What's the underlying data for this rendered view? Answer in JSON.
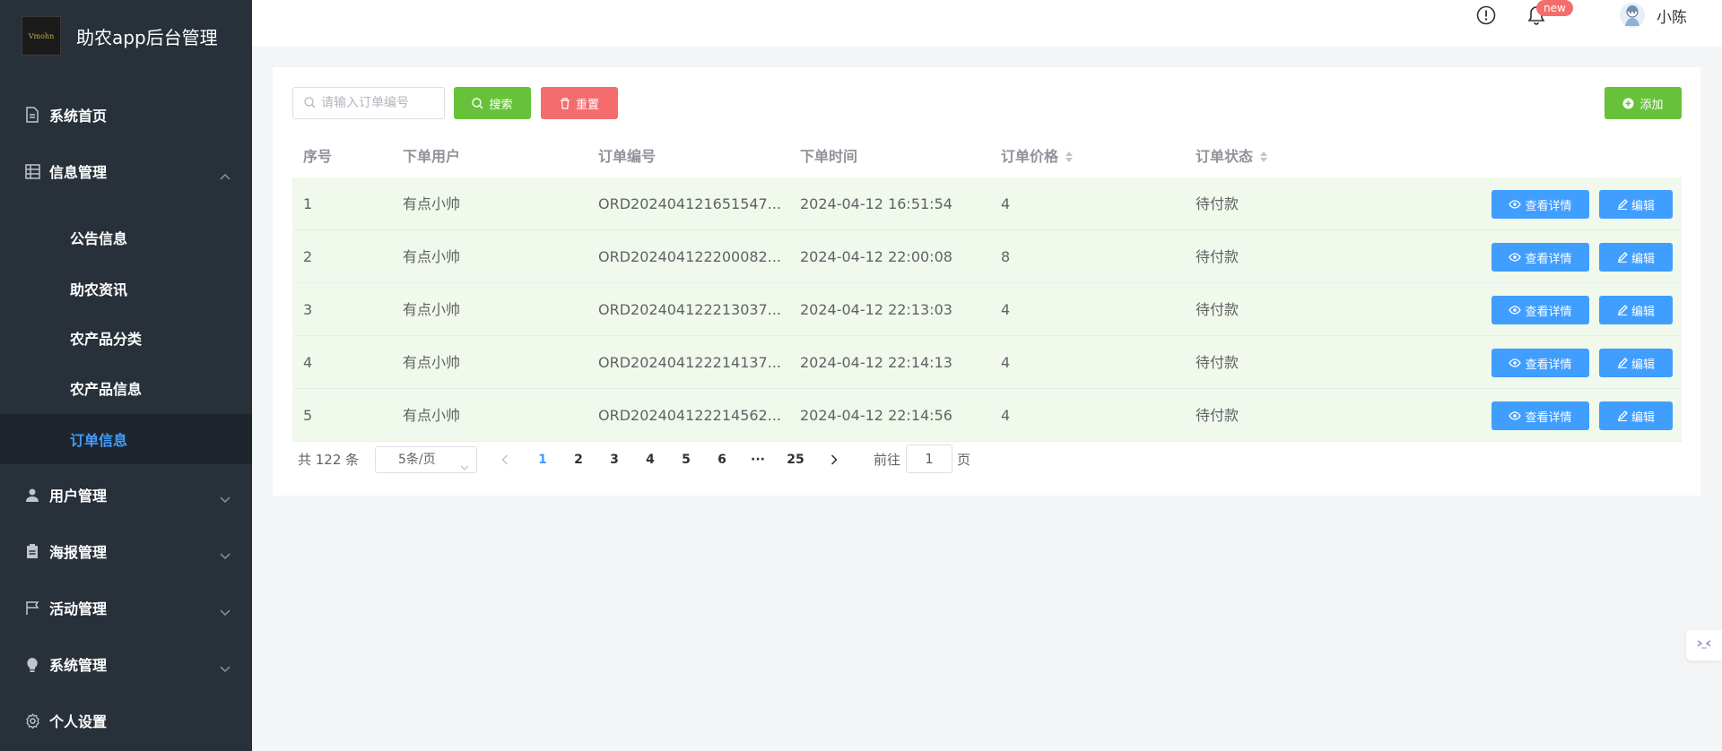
{
  "app": {
    "title": "助农app后台管理",
    "logo_text": "Vmohn"
  },
  "sidebar": {
    "items": [
      {
        "label": "系统首页",
        "icon": "document-icon"
      },
      {
        "label": "信息管理",
        "icon": "grid-icon",
        "expanded": true
      },
      {
        "label": "用户管理",
        "icon": "user-icon"
      },
      {
        "label": "海报管理",
        "icon": "clipboard-icon"
      },
      {
        "label": "活动管理",
        "icon": "flag-icon"
      },
      {
        "label": "系统管理",
        "icon": "bulb-icon"
      },
      {
        "label": "个人设置",
        "icon": "gear-icon"
      }
    ],
    "subitems": [
      {
        "label": "公告信息"
      },
      {
        "label": "助农资讯"
      },
      {
        "label": "农产品分类"
      },
      {
        "label": "农产品信息"
      },
      {
        "label": "订单信息",
        "active": true
      }
    ]
  },
  "header": {
    "badge": "new",
    "username": "小陈"
  },
  "toolbar": {
    "search_placeholder": "请输入订单编号",
    "search_label": "搜索",
    "reset_label": "重置",
    "add_label": "添加"
  },
  "table": {
    "columns": [
      "序号",
      "下单用户",
      "订单编号",
      "下单时间",
      "订单价格",
      "订单状态"
    ],
    "view_label": "查看详情",
    "edit_label": "编辑",
    "rows": [
      {
        "index": "1",
        "user": "有点小帅",
        "order_no": "ORD202404121651547...",
        "time": "2024-04-12 16:51:54",
        "price": "4",
        "status": "待付款"
      },
      {
        "index": "2",
        "user": "有点小帅",
        "order_no": "ORD202404122200082...",
        "time": "2024-04-12 22:00:08",
        "price": "8",
        "status": "待付款"
      },
      {
        "index": "3",
        "user": "有点小帅",
        "order_no": "ORD202404122213037...",
        "time": "2024-04-12 22:13:03",
        "price": "4",
        "status": "待付款"
      },
      {
        "index": "4",
        "user": "有点小帅",
        "order_no": "ORD202404122214137...",
        "time": "2024-04-12 22:14:13",
        "price": "4",
        "status": "待付款"
      },
      {
        "index": "5",
        "user": "有点小帅",
        "order_no": "ORD202404122214562...",
        "time": "2024-04-12 22:14:56",
        "price": "4",
        "status": "待付款"
      }
    ]
  },
  "pagination": {
    "total_text": "共 122 条",
    "page_size": "5条/页",
    "pages": [
      "1",
      "2",
      "3",
      "4",
      "5",
      "6",
      "···",
      "25"
    ],
    "current": "1",
    "goto_prefix": "前往",
    "goto_value": "1",
    "goto_suffix": "页"
  },
  "colors": {
    "sidebar_bg": "#28303a",
    "active_blue": "#409eff",
    "success_green": "#67c23a",
    "danger_red": "#f56c6c",
    "row_highlight": "#f0f9eb"
  }
}
